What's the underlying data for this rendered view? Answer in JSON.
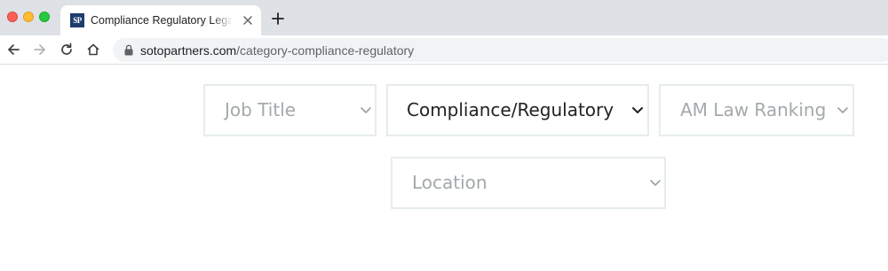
{
  "browser": {
    "tab": {
      "favicon_text": "SP",
      "title": "Compliance Regulatory Legal Jobs | Soto Partners"
    },
    "address_bar": {
      "host": "sotopartners.com",
      "path": "/category-compliance-regulatory"
    }
  },
  "filters": {
    "job_title": {
      "value": "Job Title",
      "is_placeholder": true
    },
    "practice_area": {
      "value": "Compliance/Regulatory",
      "is_placeholder": false
    },
    "am_law_ranking": {
      "value": "AM Law Ranking",
      "is_placeholder": true
    },
    "location": {
      "value": "Location",
      "is_placeholder": true
    }
  },
  "colors": {
    "placeholder_text": "#a3a9ac",
    "selected_text": "#222222",
    "select_border": "#e5ecee",
    "chrome_background": "#dee1e6",
    "favicon_background": "#1f3c6e"
  }
}
